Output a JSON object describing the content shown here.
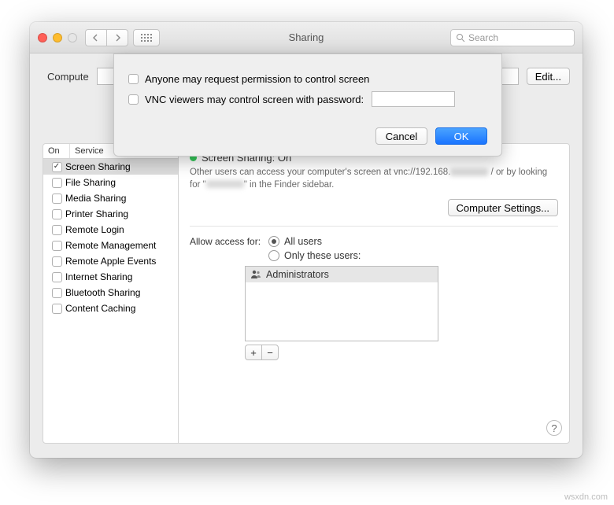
{
  "window": {
    "title": "Sharing"
  },
  "toolbar": {
    "search_placeholder": "Search"
  },
  "computerName": {
    "label": "Compute",
    "edit": "Edit..."
  },
  "services": {
    "header_on": "On",
    "header_service": "Service",
    "items": [
      {
        "label": "Screen Sharing",
        "on": true,
        "selected": true
      },
      {
        "label": "File Sharing",
        "on": false
      },
      {
        "label": "Media Sharing",
        "on": false
      },
      {
        "label": "Printer Sharing",
        "on": false
      },
      {
        "label": "Remote Login",
        "on": false
      },
      {
        "label": "Remote Management",
        "on": false
      },
      {
        "label": "Remote Apple Events",
        "on": false
      },
      {
        "label": "Internet Sharing",
        "on": false
      },
      {
        "label": "Bluetooth Sharing",
        "on": false
      },
      {
        "label": "Content Caching",
        "on": false
      }
    ]
  },
  "detail": {
    "status": "Screen Sharing: On",
    "desc_prefix": "Other users can access your computer's screen at vnc://192.168.",
    "desc_mid": "/ or by looking for \"",
    "desc_suffix": "\" in the Finder sidebar.",
    "computer_settings": "Computer Settings...",
    "allow_label": "Allow access for:",
    "radio_all": "All users",
    "radio_only": "Only these users:",
    "user_admin": "Administrators",
    "plus": "+",
    "minus": "−"
  },
  "sheet": {
    "opt1": "Anyone may request permission to control screen",
    "opt2": "VNC viewers may control screen with password:",
    "cancel": "Cancel",
    "ok": "OK"
  },
  "help": "?",
  "watermark": "wsxdn.com"
}
